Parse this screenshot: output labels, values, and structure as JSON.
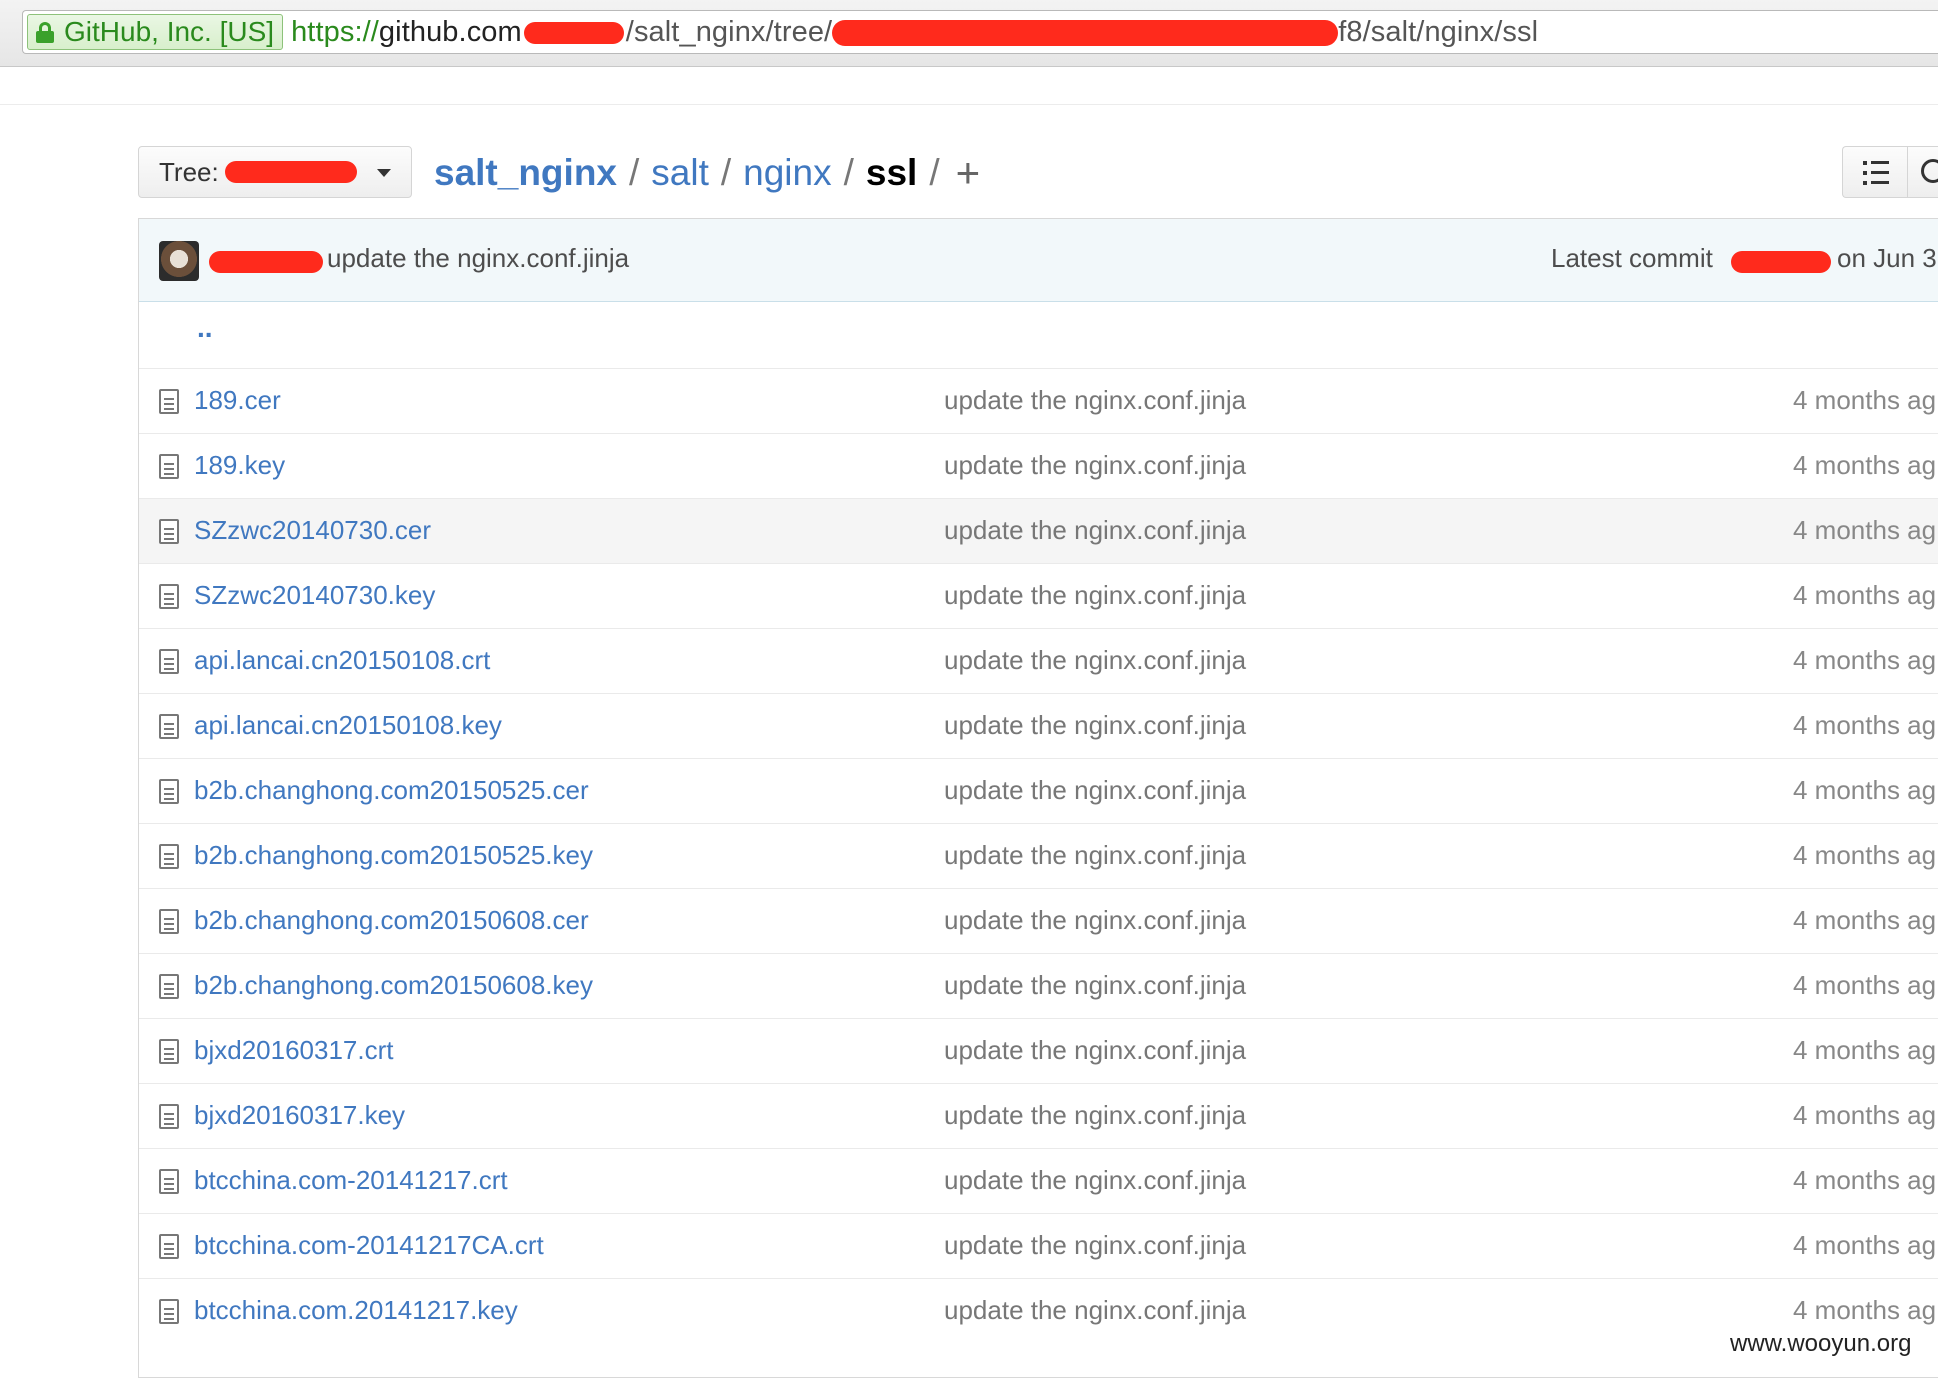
{
  "browser": {
    "ev_label": "GitHub, Inc. [US]",
    "url_scheme": "https://",
    "url_host": "github.com",
    "url_mid": "/salt_nginx/tree/",
    "url_tail": "f8/salt/nginx/ssl"
  },
  "tree_selector": {
    "label": "Tree:"
  },
  "breadcrumb": {
    "repo": "salt_nginx",
    "parts": [
      "salt",
      "nginx"
    ],
    "current": "ssl",
    "separator": "/",
    "add": "+"
  },
  "commit_tease": {
    "message": "update the nginx.conf.jinja",
    "latest_label": "Latest commit",
    "date": "on Jun 3"
  },
  "parent_link": "..",
  "files": [
    {
      "name": "189.cer",
      "message": "update the nginx.conf.jinja",
      "age": "4 months ag"
    },
    {
      "name": "189.key",
      "message": "update the nginx.conf.jinja",
      "age": "4 months ag"
    },
    {
      "name": "SZzwc20140730.cer",
      "message": "update the nginx.conf.jinja",
      "age": "4 months ag"
    },
    {
      "name": "SZzwc20140730.key",
      "message": "update the nginx.conf.jinja",
      "age": "4 months ag"
    },
    {
      "name": "api.lancai.cn20150108.crt",
      "message": "update the nginx.conf.jinja",
      "age": "4 months ag"
    },
    {
      "name": "api.lancai.cn20150108.key",
      "message": "update the nginx.conf.jinja",
      "age": "4 months ag"
    },
    {
      "name": "b2b.changhong.com20150525.cer",
      "message": "update the nginx.conf.jinja",
      "age": "4 months ag"
    },
    {
      "name": "b2b.changhong.com20150525.key",
      "message": "update the nginx.conf.jinja",
      "age": "4 months ag"
    },
    {
      "name": "b2b.changhong.com20150608.cer",
      "message": "update the nginx.conf.jinja",
      "age": "4 months ag"
    },
    {
      "name": "b2b.changhong.com20150608.key",
      "message": "update the nginx.conf.jinja",
      "age": "4 months ag"
    },
    {
      "name": "bjxd20160317.crt",
      "message": "update the nginx.conf.jinja",
      "age": "4 months ag"
    },
    {
      "name": "bjxd20160317.key",
      "message": "update the nginx.conf.jinja",
      "age": "4 months ag"
    },
    {
      "name": "btcchina.com-20141217.crt",
      "message": "update the nginx.conf.jinja",
      "age": "4 months ag"
    },
    {
      "name": "btcchina.com-20141217CA.crt",
      "message": "update the nginx.conf.jinja",
      "age": "4 months ag"
    },
    {
      "name": "btcchina.com.20141217.key",
      "message": "update the nginx.conf.jinja",
      "age": "4 months ag"
    }
  ],
  "watermark": "www.wooyun.org",
  "colors": {
    "link": "#4078c0",
    "redaction": "#ff2a1c",
    "ev_green": "#2a8a1d",
    "commit_bg": "#f2f8fa"
  }
}
